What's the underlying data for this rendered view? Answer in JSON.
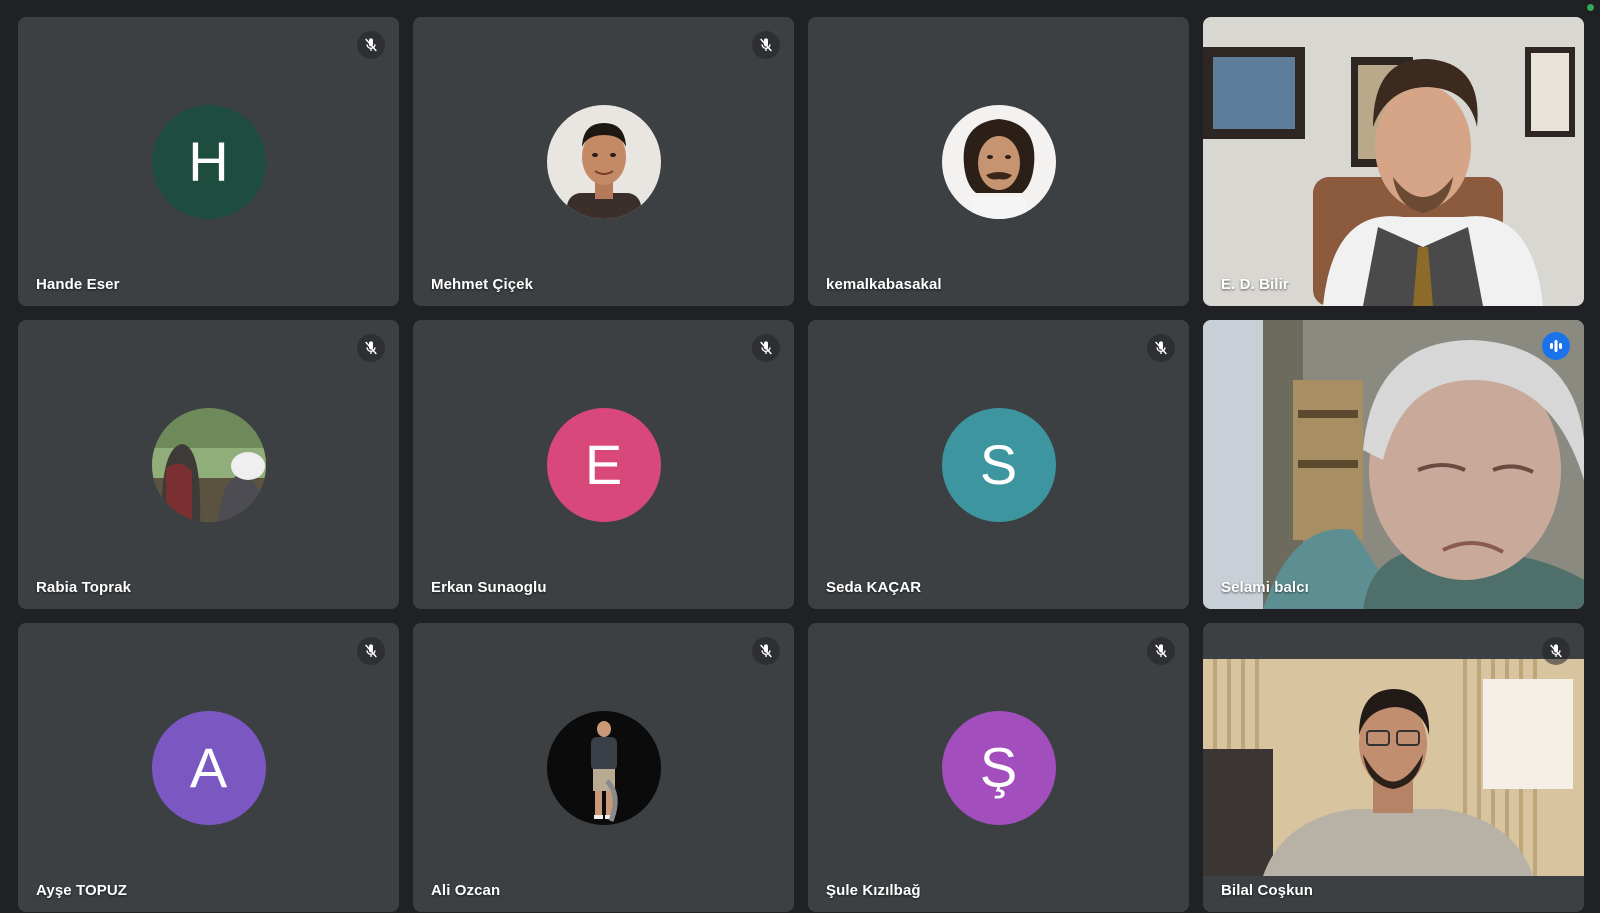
{
  "meeting": {
    "active_speaker": "Selami balcı"
  },
  "colors": {
    "tile_bg": "#3c4043",
    "page_bg": "#202124",
    "speaking_outline": "#8ab4f8",
    "avatar_h": "#1e4d3f",
    "avatar_e": "#d9487a",
    "avatar_s": "#3d95a0",
    "avatar_a": "#7b57c2",
    "avatar_sh": "#a24fbd"
  },
  "participants": [
    {
      "name": "Hande Eser",
      "initial": "H",
      "display": "initial-avatar",
      "mic": "muted-mic-icon"
    },
    {
      "name": "Mehmet Çiçek",
      "display": "photo-avatar",
      "mic": "muted-mic-icon"
    },
    {
      "name": "kemalkabasakal",
      "display": "photo-avatar",
      "mic": "none"
    },
    {
      "name": "E. D. Bilir",
      "display": "video",
      "mic": "none"
    },
    {
      "name": "Rabia Toprak",
      "display": "photo-avatar",
      "mic": "muted-mic-icon"
    },
    {
      "name": "Erkan Sunaoglu",
      "initial": "E",
      "display": "initial-avatar",
      "mic": "muted-mic-icon"
    },
    {
      "name": "Seda KAÇAR",
      "initial": "S",
      "display": "initial-avatar",
      "mic": "muted-mic-icon"
    },
    {
      "name": "Selami balcı",
      "display": "video",
      "mic": "speaking-indicator-icon"
    },
    {
      "name": "Ayşe TOPUZ",
      "initial": "A",
      "display": "initial-avatar",
      "mic": "muted-mic-icon"
    },
    {
      "name": "Ali Ozcan",
      "display": "photo-avatar",
      "mic": "muted-mic-icon"
    },
    {
      "name": "Şule Kızılbağ",
      "initial": "Ş",
      "display": "initial-avatar",
      "mic": "muted-mic-icon"
    },
    {
      "name": "Bilal Coşkun",
      "display": "video",
      "mic": "muted-mic-icon"
    }
  ]
}
